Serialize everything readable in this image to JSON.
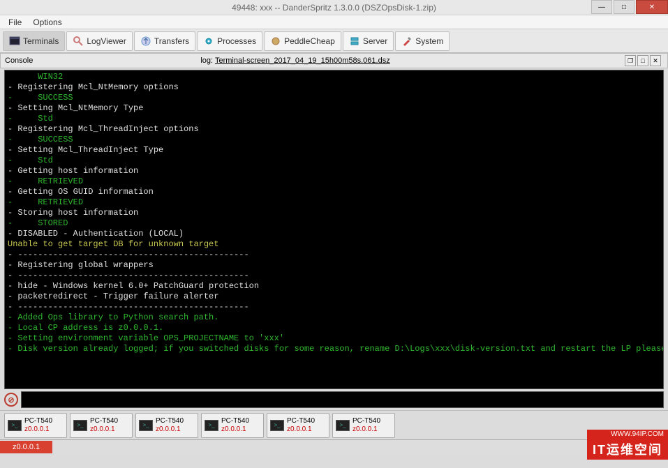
{
  "window": {
    "title": "49448: xxx -- DanderSpritz 1.3.0.0 (DSZOpsDisk-1.zip)",
    "min_label": "—",
    "max_label": "□",
    "close_label": "✕"
  },
  "menu": {
    "file": "File",
    "options": "Options"
  },
  "toolbar": {
    "terminals": "Terminals",
    "logviewer": "LogViewer",
    "transfers": "Transfers",
    "processes": "Processes",
    "peddlecheap": "PeddleCheap",
    "server": "Server",
    "system": "System"
  },
  "console": {
    "title": "Console",
    "log_label": "log:",
    "log_file": "Terminal-screen_2017_04_19_15h00m58s.061.dsz"
  },
  "terminal_lines": [
    {
      "cls": "c-green",
      "text": "      WIN32"
    },
    {
      "cls": "c-white",
      "text": "- Registering Mcl_NtMemory options"
    },
    {
      "cls": "c-green",
      "text": "-     SUCCESS"
    },
    {
      "cls": "c-white",
      "text": "- Setting Mcl_NtMemory Type"
    },
    {
      "cls": "c-green",
      "text": "-     Std"
    },
    {
      "cls": "c-white",
      "text": "- Registering Mcl_ThreadInject options"
    },
    {
      "cls": "c-green",
      "text": "-     SUCCESS"
    },
    {
      "cls": "c-white",
      "text": "- Setting Mcl_ThreadInject Type"
    },
    {
      "cls": "c-green",
      "text": "-     Std"
    },
    {
      "cls": "c-white",
      "text": "- Getting host information"
    },
    {
      "cls": "c-green",
      "text": "-     RETRIEVED"
    },
    {
      "cls": "c-white",
      "text": "- Getting OS GUID information"
    },
    {
      "cls": "c-green",
      "text": "-     RETRIEVED"
    },
    {
      "cls": "c-white",
      "text": "- Storing host information"
    },
    {
      "cls": "c-green",
      "text": "-     STORED"
    },
    {
      "cls": "c-white",
      "text": "- DISABLED - Authentication (LOCAL)"
    },
    {
      "cls": "c-yellow",
      "text": "Unable to get target DB for unknown target"
    },
    {
      "cls": "c-white",
      "text": ""
    },
    {
      "cls": "c-white",
      "text": "- ----------------------------------------------"
    },
    {
      "cls": "c-white",
      "text": "- Registering global wrappers"
    },
    {
      "cls": "c-white",
      "text": "- ----------------------------------------------"
    },
    {
      "cls": "c-white",
      "text": "- hide - Windows kernel 6.0+ PatchGuard protection"
    },
    {
      "cls": "c-white",
      "text": "- packetredirect - Trigger failure alerter"
    },
    {
      "cls": "c-white",
      "text": "- ----------------------------------------------"
    },
    {
      "cls": "c-green",
      "text": "- Added Ops library to Python search path."
    },
    {
      "cls": "c-green",
      "text": "- Local CP address is z0.0.0.1."
    },
    {
      "cls": "c-green",
      "text": "- Setting environment variable OPS_PROJECTNAME to 'xxx'"
    },
    {
      "cls": "c-green",
      "text": "- Disk version already logged; if you switched disks for some reason, rename D:\\Logs\\xxx\\disk-version.txt and restart the LP please"
    }
  ],
  "sessions": [
    {
      "name": "PC-T540",
      "ip": "z0.0.0.1"
    },
    {
      "name": "PC-T540",
      "ip": "z0.0.0.1"
    },
    {
      "name": "PC-T540",
      "ip": "z0.0.0.1"
    },
    {
      "name": "PC-T540",
      "ip": "z0.0.0.1"
    },
    {
      "name": "PC-T540",
      "ip": "z0.0.0.1"
    },
    {
      "name": "PC-T540",
      "ip": "z0.0.0.1"
    }
  ],
  "status": {
    "ip": "z0.0.0.1"
  },
  "watermark": {
    "url": "WWW.94IP.COM",
    "brand": "IT运维空间"
  }
}
